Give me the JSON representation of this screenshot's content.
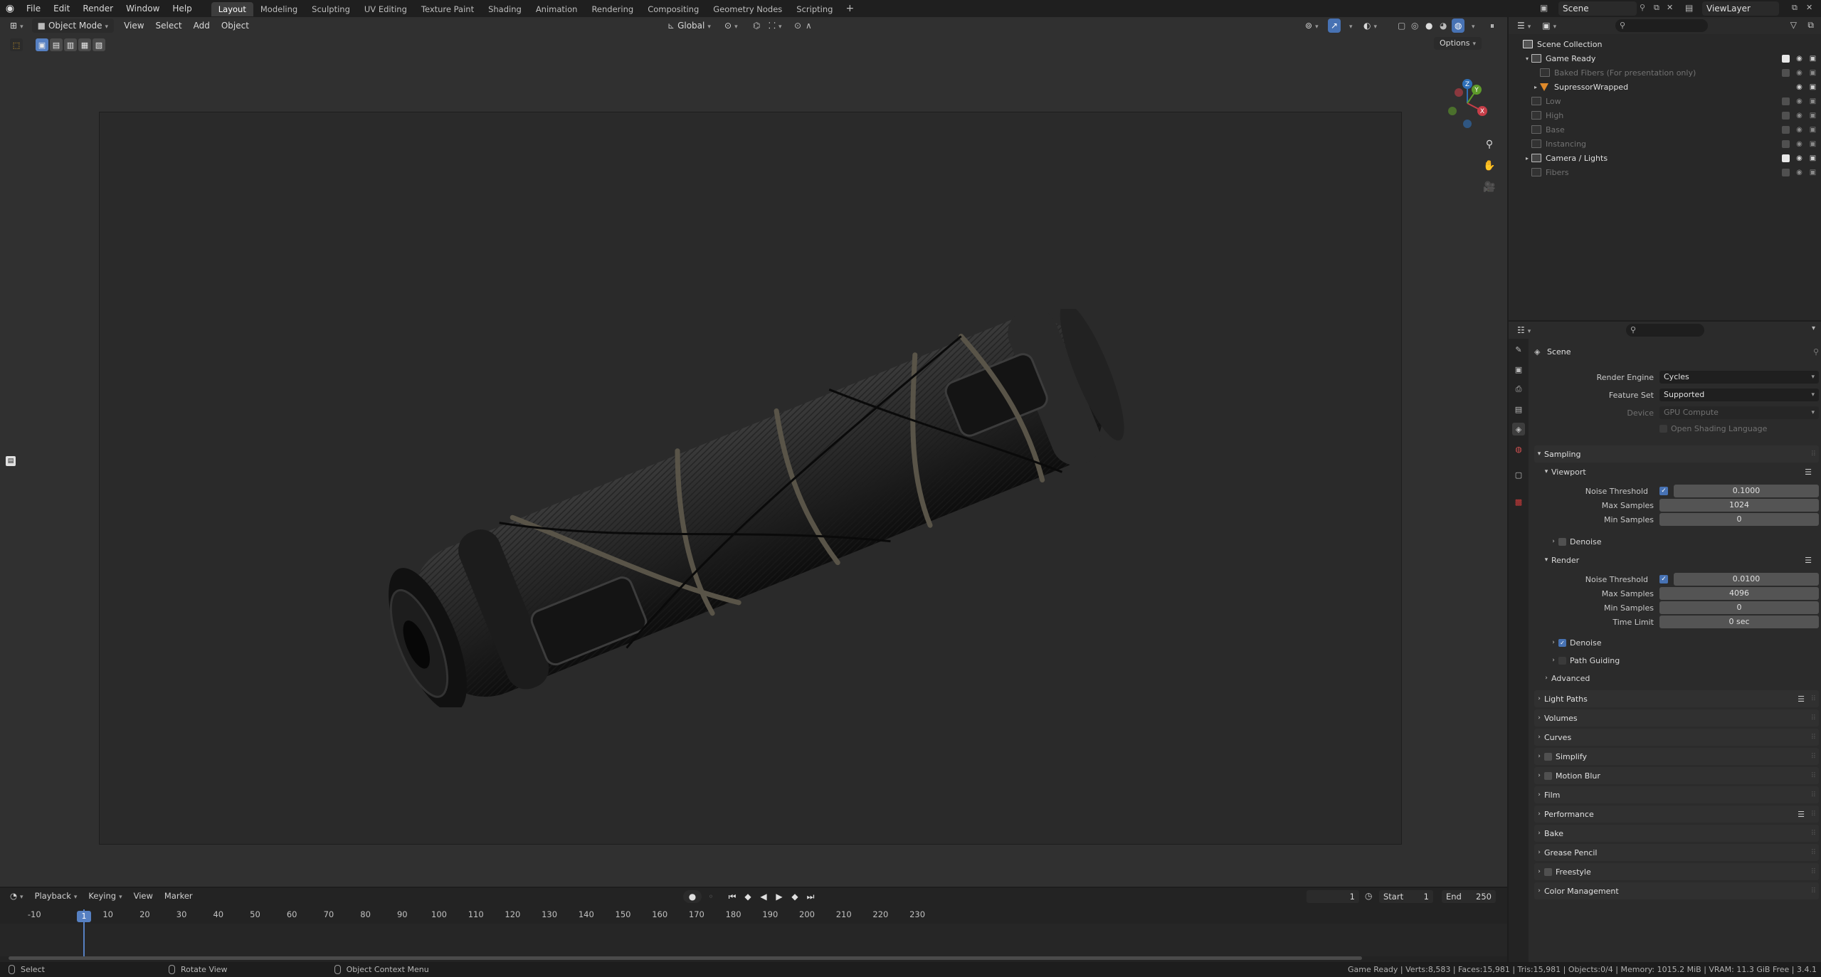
{
  "topbar": {
    "menus": [
      "File",
      "Edit",
      "Render",
      "Window",
      "Help"
    ],
    "workspaces": [
      "Layout",
      "Modeling",
      "Sculpting",
      "UV Editing",
      "Texture Paint",
      "Shading",
      "Animation",
      "Rendering",
      "Compositing",
      "Geometry Nodes",
      "Scripting"
    ],
    "active_workspace": "Layout",
    "scene": "Scene",
    "view_layer": "ViewLayer"
  },
  "viewport": {
    "mode": "Object Mode",
    "menus": [
      "View",
      "Select",
      "Add",
      "Object"
    ],
    "orientation": "Global",
    "options_label": "Options",
    "gizmo_axes": [
      "X",
      "Y",
      "Z"
    ]
  },
  "timeline": {
    "menus": [
      "Playback",
      "Keying",
      "View",
      "Marker"
    ],
    "current_frame": "1",
    "start_label": "Start",
    "start_value": "1",
    "end_label": "End",
    "end_value": "250",
    "ticks": [
      "-10",
      "1",
      "10",
      "20",
      "30",
      "40",
      "50",
      "60",
      "70",
      "80",
      "90",
      "100",
      "110",
      "120",
      "130",
      "140",
      "150",
      "160",
      "170",
      "180",
      "190",
      "200",
      "210",
      "220",
      "230"
    ]
  },
  "statusbar": {
    "select": "Select",
    "rotate": "Rotate View",
    "context": "Object Context Menu",
    "stats": "Game Ready | Verts:8,583 | Faces:15,981 | Tris:15,981 | Objects:0/4 | Memory: 1015.2 MiB | VRAM: 11.3 GiB Free | 3.4.1"
  },
  "outliner": {
    "root": "Scene Collection",
    "rows": [
      {
        "label": "Game Ready",
        "indent": 1,
        "arrow": "▾",
        "dim": false,
        "checked": true
      },
      {
        "label": "Baked Fibers (For presentation only)",
        "indent": 2,
        "arrow": "",
        "dim": true,
        "checked": false
      },
      {
        "label": "SupressorWrapped",
        "indent": 2,
        "arrow": "▸",
        "dim": false,
        "checked": null
      },
      {
        "label": "Low",
        "indent": 1,
        "arrow": "",
        "dim": true,
        "checked": false
      },
      {
        "label": "High",
        "indent": 1,
        "arrow": "",
        "dim": true,
        "checked": false
      },
      {
        "label": "Base",
        "indent": 1,
        "arrow": "",
        "dim": true,
        "checked": false
      },
      {
        "label": "Instancing",
        "indent": 1,
        "arrow": "",
        "dim": true,
        "checked": false
      },
      {
        "label": "Camera / Lights",
        "indent": 1,
        "arrow": "▸",
        "dim": false,
        "checked": true
      },
      {
        "label": "Fibers",
        "indent": 1,
        "arrow": "",
        "dim": true,
        "checked": false
      }
    ]
  },
  "properties": {
    "context": "Scene",
    "render_engine_label": "Render Engine",
    "render_engine": "Cycles",
    "feature_set_label": "Feature Set",
    "feature_set": "Supported",
    "device_label": "Device",
    "device": "GPU Compute",
    "osl": "Open Shading Language",
    "sampling": "Sampling",
    "viewport": "Viewport",
    "vp_noise_label": "Noise Threshold",
    "vp_noise": "0.1000",
    "vp_max_label": "Max Samples",
    "vp_max": "1024",
    "vp_min_label": "Min Samples",
    "vp_min": "0",
    "denoise": "Denoise",
    "render": "Render",
    "r_noise_label": "Noise Threshold",
    "r_noise": "0.0100",
    "r_max_label": "Max Samples",
    "r_max": "4096",
    "r_min_label": "Min Samples",
    "r_min": "0",
    "r_time_label": "Time Limit",
    "r_time": "0 sec",
    "r_denoise": "Denoise",
    "path_guiding": "Path Guiding",
    "advanced": "Advanced",
    "panels": [
      {
        "label": "Light Paths",
        "checkbox": null,
        "list": true
      },
      {
        "label": "Volumes",
        "checkbox": null,
        "list": false
      },
      {
        "label": "Curves",
        "checkbox": null,
        "list": false
      },
      {
        "label": "Simplify",
        "checkbox": false,
        "list": false
      },
      {
        "label": "Motion Blur",
        "checkbox": false,
        "list": false
      },
      {
        "label": "Film",
        "checkbox": null,
        "list": false
      },
      {
        "label": "Performance",
        "checkbox": null,
        "list": true
      },
      {
        "label": "Bake",
        "checkbox": null,
        "list": false
      },
      {
        "label": "Grease Pencil",
        "checkbox": null,
        "list": false
      },
      {
        "label": "Freestyle",
        "checkbox": false,
        "list": false
      },
      {
        "label": "Color Management",
        "checkbox": null,
        "list": false
      }
    ]
  }
}
